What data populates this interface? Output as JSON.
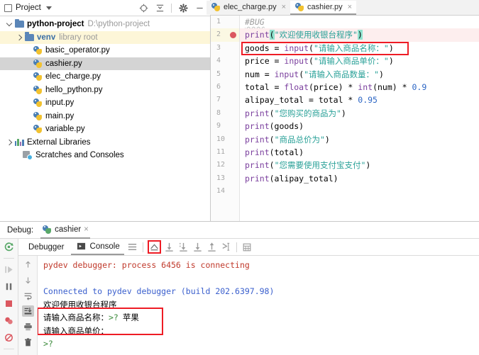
{
  "project": {
    "header": {
      "title": "Project",
      "icons": [
        "locate-icon",
        "collapse-all-icon",
        "settings-gear-icon",
        "minimize-icon"
      ]
    },
    "tree": [
      {
        "label": "python-project",
        "path": "D:\\python-project",
        "kind": "folder",
        "depth": 0,
        "expanded": true,
        "state": "normal"
      },
      {
        "label": "venv",
        "path": "library root",
        "kind": "folder",
        "depth": 1,
        "expanded": false,
        "state": "highlighted"
      },
      {
        "label": "basic_operator.py",
        "kind": "python-file",
        "depth": 2,
        "state": "normal"
      },
      {
        "label": "cashier.py",
        "kind": "python-file",
        "depth": 2,
        "state": "selected"
      },
      {
        "label": "elec_charge.py",
        "kind": "python-file",
        "depth": 2,
        "state": "normal"
      },
      {
        "label": "hello_python.py",
        "kind": "python-file",
        "depth": 2,
        "state": "normal"
      },
      {
        "label": "input.py",
        "kind": "python-file",
        "depth": 2,
        "state": "normal"
      },
      {
        "label": "main.py",
        "kind": "python-file",
        "depth": 2,
        "state": "normal"
      },
      {
        "label": "variable.py",
        "kind": "python-file",
        "depth": 2,
        "state": "normal"
      },
      {
        "label": "External Libraries",
        "kind": "libraries",
        "depth": 0,
        "expanded": false,
        "state": "normal"
      },
      {
        "label": "Scratches and Consoles",
        "kind": "scratches",
        "depth": 0,
        "state": "normal"
      }
    ]
  },
  "editor": {
    "tabs": [
      {
        "label": "elec_charge.py",
        "active": false,
        "close": "×"
      },
      {
        "label": "cashier.py",
        "active": true,
        "close": "×"
      }
    ],
    "line_numbers": [
      "1",
      "2",
      "3",
      "4",
      "5",
      "6",
      "7",
      "8",
      "9",
      "10",
      "11",
      "12",
      "13",
      "14"
    ],
    "breakpoint_line": 2,
    "executing_line": 2,
    "highlight_box_line": 3,
    "code": [
      {
        "n": 1,
        "text": "#BUG"
      },
      {
        "n": 2,
        "text": "print(\"欢迎使用收银台程序\")"
      },
      {
        "n": 3,
        "text": "goods = input(\"请输入商品名称：\")"
      },
      {
        "n": 4,
        "text": "price = input(\"请输入商品单价：\")"
      },
      {
        "n": 5,
        "text": "num = input(\"请输入商品数量：\")"
      },
      {
        "n": 6,
        "text": "total = float(price) * int(num) * 0.9"
      },
      {
        "n": 7,
        "text": "alipay_total = total * 0.95"
      },
      {
        "n": 8,
        "text": "print(\"您购买的商品为\")"
      },
      {
        "n": 9,
        "text": "print(goods)"
      },
      {
        "n": 10,
        "text": "print(\"商品总价为\")"
      },
      {
        "n": 11,
        "text": "print(total)"
      },
      {
        "n": 12,
        "text": "print(\"您需要使用支付宝支付\")"
      },
      {
        "n": 13,
        "text": "print(alipay_total)"
      },
      {
        "n": 14,
        "text": ""
      }
    ],
    "tokens": {
      "l1": {
        "comment": "#BUG"
      },
      "l2": {
        "kw": "print",
        "p1": "(",
        "str": "\"欢迎使用收银台程序\"",
        "p2": ")"
      },
      "l3": {
        "var": "goods",
        "eq": " = ",
        "kw": "input",
        "open": "(",
        "str": "\"请输入商品名称：\"",
        "close": ")"
      },
      "l4": {
        "var": "price",
        "eq": " = ",
        "kw": "input",
        "open": "(",
        "str": "\"请输入商品单价：\"",
        "close": ")"
      },
      "l5": {
        "var": "num",
        "eq": " = ",
        "kw": "input",
        "open": "(",
        "str": "\"请输入商品数量：\"",
        "close": ")"
      },
      "l6": {
        "var": "total",
        "eq": " = ",
        "f1": "float",
        "a1": "(price)",
        "op1": " * ",
        "f2": "int",
        "a2": "(num)",
        "op2": " * ",
        "num": "0.9"
      },
      "l7": {
        "var": "alipay_total",
        "eq": " = ",
        "rhs": "total * ",
        "num": "0.95"
      },
      "l8": {
        "kw": "print",
        "open": "(",
        "str": "\"您购买的商品为\"",
        "close": ")"
      },
      "l9": {
        "kw": "print",
        "rest": "(goods)"
      },
      "l10": {
        "kw": "print",
        "open": "(",
        "str": "\"商品总价为\"",
        "close": ")"
      },
      "l11": {
        "kw": "print",
        "rest": "(total)"
      },
      "l12": {
        "kw": "print",
        "open": "(",
        "str": "\"您需要使用支付宝支付\"",
        "close": ")"
      },
      "l13": {
        "kw": "print",
        "rest": "(alipay_total)"
      }
    }
  },
  "debug": {
    "label": "Debug:",
    "session": "cashier",
    "session_close": "×",
    "rerun_icon": "rerun-icon",
    "rail_icons": [
      "resume-program-icon",
      "pause-program-icon",
      "stop-icon",
      "view-breakpoints-icon",
      "mute-breakpoints-icon"
    ],
    "tabs": [
      {
        "label": "Debugger",
        "active": false,
        "icon": null
      },
      {
        "label": "Console",
        "active": true,
        "icon": "console-icon"
      }
    ],
    "toolbar_icons": [
      "layout-settings-icon",
      "show-python-prompt-icon",
      "step-over-icon",
      "step-into-icon",
      "force-step-into-icon",
      "step-out-icon",
      "run-to-cursor-icon",
      "evaluate-expression-icon"
    ],
    "boxed_toolbar_icon": "show-python-prompt-icon",
    "console_rail_icons": [
      "scroll-up-icon",
      "scroll-down-icon",
      "soft-wrap-icon",
      "scroll-to-end-icon",
      "print-icon",
      "clear-all-icon"
    ],
    "selected_console_rail_icon": "scroll-to-end-icon",
    "console_lines": [
      {
        "text": "pydev debugger: process 6456 is connecting",
        "style": "err"
      },
      {
        "text": "",
        "style": "blank"
      },
      {
        "text": "Connected to pydev debugger (build 202.6397.98)",
        "style": "info"
      },
      {
        "text": "欢迎使用收银台程序",
        "style": "out"
      },
      {
        "text": "请输入商品名称：",
        "style": "out",
        "prompt": ">?",
        "input": "苹果"
      },
      {
        "text": "请输入商品单价：",
        "style": "out"
      },
      {
        "text": "",
        "style": "out",
        "prompt": ">?"
      }
    ]
  },
  "annotations": {
    "color": "#ee1c25",
    "boxes": [
      "code-line-3-box",
      "toolbar-icon-box",
      "console-input-box"
    ]
  }
}
